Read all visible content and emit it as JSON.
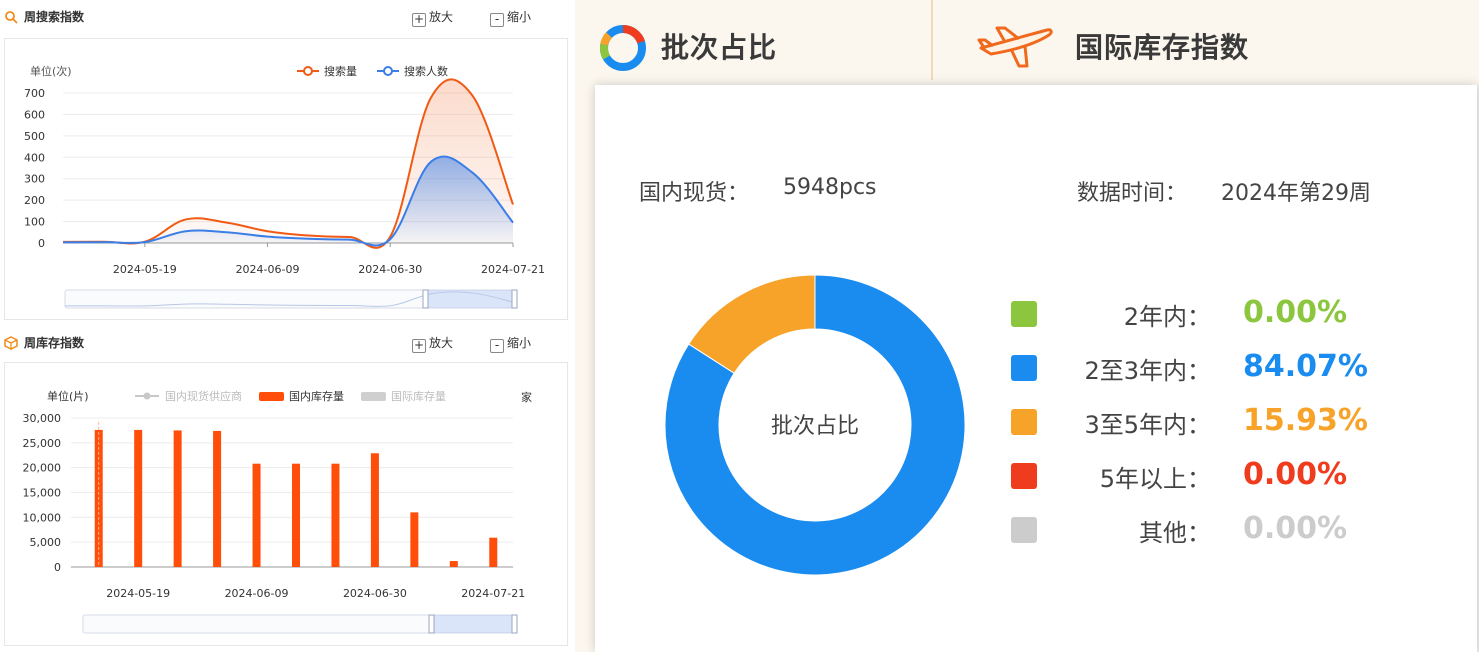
{
  "search_section": {
    "title": "周搜索指数",
    "zoom_in": "放大",
    "zoom_out": "缩小"
  },
  "stock_section": {
    "title": "周库存指数",
    "zoom_in": "放大",
    "zoom_out": "缩小",
    "right_label": "家"
  },
  "tabs": {
    "batch": "批次占比",
    "intl": "国际库存指数"
  },
  "card": {
    "domestic_label": "国内现货：",
    "domestic_value": "5948pcs",
    "time_label": "数据时间：",
    "time_value": "2024年第29周",
    "donut_center": "批次占比"
  },
  "colors": {
    "orange": "#f05a14",
    "blue": "#3a7ee8",
    "accent": "#f5a623"
  },
  "chart_data": [
    {
      "type": "area",
      "ylabel": "单位(次)",
      "x": [
        "2024-05-05",
        "2024-05-12",
        "2024-05-19",
        "2024-05-26",
        "2024-06-02",
        "2024-06-09",
        "2024-06-16",
        "2024-06-23",
        "2024-06-30",
        "2024-07-07",
        "2024-07-14",
        "2024-07-21"
      ],
      "x_ticks": [
        "2024-05-19",
        "2024-06-09",
        "2024-06-30",
        "2024-07-21"
      ],
      "yticks": [
        0,
        100,
        200,
        300,
        400,
        500,
        600,
        700
      ],
      "ylim": [
        0,
        700
      ],
      "series": [
        {
          "name": "搜索量",
          "color": "#f05a14",
          "values": [
            5,
            6,
            6,
            110,
            95,
            55,
            35,
            28,
            30,
            680,
            690,
            180
          ]
        },
        {
          "name": "搜索人数",
          "color": "#3a7ee8",
          "values": [
            3,
            4,
            4,
            55,
            50,
            30,
            20,
            16,
            18,
            380,
            330,
            95
          ]
        }
      ],
      "legend_position": "top-right"
    },
    {
      "type": "bar",
      "ylabel": "单位(片)",
      "x": [
        "2024-05-12",
        "2024-05-19",
        "2024-05-26",
        "2024-06-02",
        "2024-06-09",
        "2024-06-16",
        "2024-06-23",
        "2024-06-30",
        "2024-07-07",
        "2024-07-14",
        "2024-07-21"
      ],
      "x_ticks": [
        "2024-05-19",
        "2024-06-09",
        "2024-06-30",
        "2024-07-21"
      ],
      "yticks": [
        0,
        5000,
        10000,
        15000,
        20000,
        25000,
        30000
      ],
      "ytick_labels": [
        "0",
        "5,000",
        "10,000",
        "15,000",
        "20,000",
        "25,000",
        "30,000"
      ],
      "ylim": [
        0,
        30000
      ],
      "legend": [
        "国内现货供应商",
        "国内库存量",
        "国际库存量"
      ],
      "series": [
        {
          "name": "国内库存量",
          "color": "#ff4d0a",
          "values": [
            27600,
            27600,
            27500,
            27400,
            20800,
            20800,
            20800,
            22900,
            11000,
            1200,
            5900
          ]
        }
      ],
      "legend_position": "top"
    },
    {
      "type": "pie",
      "title": "批次占比",
      "categories": [
        "2年内",
        "2至3年内",
        "3至5年内",
        "5年以上",
        "其他"
      ],
      "labels": [
        "2年内：",
        "2至3年内：",
        "3至5年内：",
        "5年以上：",
        "其他："
      ],
      "values": [
        0.0,
        84.07,
        15.93,
        0.0,
        0.0
      ],
      "display": [
        "0.00%",
        "84.07%",
        "15.93%",
        "0.00%",
        "0.00%"
      ],
      "colors": [
        "#8cc63f",
        "#1a8cf0",
        "#f7a228",
        "#f03c1e",
        "#cccccc"
      ]
    }
  ]
}
